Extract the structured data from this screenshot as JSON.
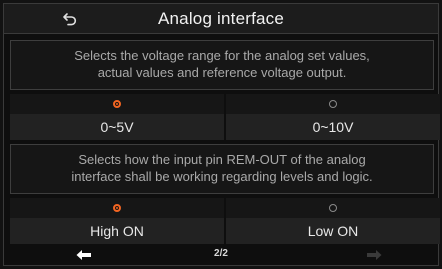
{
  "header": {
    "title": "Analog interface",
    "back_icon": "back-arrow-icon"
  },
  "section1": {
    "description_line1": "Selects the voltage range for the analog set values,",
    "description_line2": "actual values and reference voltage output.",
    "options": [
      {
        "label": "0~5V",
        "selected": true
      },
      {
        "label": "0~10V",
        "selected": false
      }
    ]
  },
  "section2": {
    "description_line1": "Selects how the input pin REM-OUT of the analog",
    "description_line2": "interface shall be working regarding levels and logic.",
    "options": [
      {
        "label": "High ON",
        "selected": true
      },
      {
        "label": "Low ON",
        "selected": false
      }
    ]
  },
  "footer": {
    "page_indicator": "2/2",
    "prev_icon": "arrow-left-icon",
    "next_icon": "arrow-right-icon"
  },
  "colors": {
    "accent": "#f26522",
    "background": "#0e0e0e",
    "text_muted": "#a9a9a9",
    "next_disabled": "#3a3a3a"
  }
}
